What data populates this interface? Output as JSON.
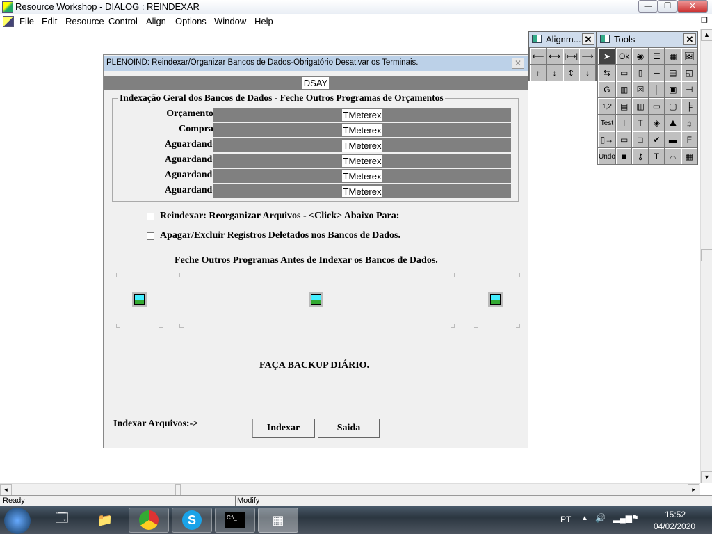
{
  "app": {
    "title": "Resource Workshop - DIALOG : REINDEXAR"
  },
  "menu": [
    "File",
    "Edit",
    "Resource",
    "Control",
    "Align",
    "Options",
    "Window",
    "Help"
  ],
  "window_buttons": {
    "minimize": "—",
    "restore": "❐",
    "close": "✕"
  },
  "dialog": {
    "title": "PLENOIND: Reindexar/Organizar Bancos de Dados-Obrigatório Desativar os Terminais.",
    "header_control": "DSAY",
    "group_title": "Indexação Geral dos Bancos de Dados - Feche Outros Programas de Orçamentos",
    "rows": [
      {
        "label": "Orçamentos:",
        "control": "TMeterex"
      },
      {
        "label": "Compras:",
        "control": "TMeterex"
      },
      {
        "label": "Aguardando:",
        "control": "TMeterex"
      },
      {
        "label": "Aguardando:",
        "control": "TMeterex"
      },
      {
        "label": "Aguardando:",
        "control": "TMeterex"
      },
      {
        "label": "Aguardando:",
        "control": "TMeterex"
      }
    ],
    "checkbox1": "Reindexar: Reorganizar Arquivos - <Click> Abaixo Para:",
    "checkbox2": "Apagar/Excluir Registros Deletados nos Bancos de Dados.",
    "notice": "Feche Outros Programas Antes de Indexar os Bancos de Dados.",
    "backup": "FAÇA BACKUP DIÁRIO.",
    "index_label": "Indexar Arquivos:->",
    "btn_index": "Indexar",
    "btn_exit": "Saida"
  },
  "alignment_palette": {
    "title": "Alignm...",
    "tools": [
      "⟵",
      "⟷",
      "|⟷|",
      "⟶",
      "↑",
      "↕",
      "⇕",
      "↓"
    ]
  },
  "tools_palette": {
    "title": "Tools",
    "tools": [
      "➤",
      "Ok",
      "◉",
      "☰",
      "▦",
      "🖼",
      "⇆",
      "▭",
      "▯",
      "─",
      "▤",
      "◱",
      "G",
      "▥",
      "☒",
      "│",
      "▣",
      "⊣",
      "1,2",
      "▤",
      "▥",
      "▭",
      "▢",
      "╞",
      "Test",
      "I",
      "T",
      "◈",
      "⛰",
      "☼",
      "▯→",
      "▭",
      "□",
      "✔",
      "▬",
      "F",
      "Undo",
      "■",
      "⚷",
      "T",
      "⌓",
      "▦"
    ]
  },
  "status": {
    "left": "Ready",
    "mid": "Modify"
  },
  "taskbar": {
    "lang": "PT",
    "time": "15:52",
    "date": "04/02/2020",
    "cmd": "C:\\_"
  }
}
